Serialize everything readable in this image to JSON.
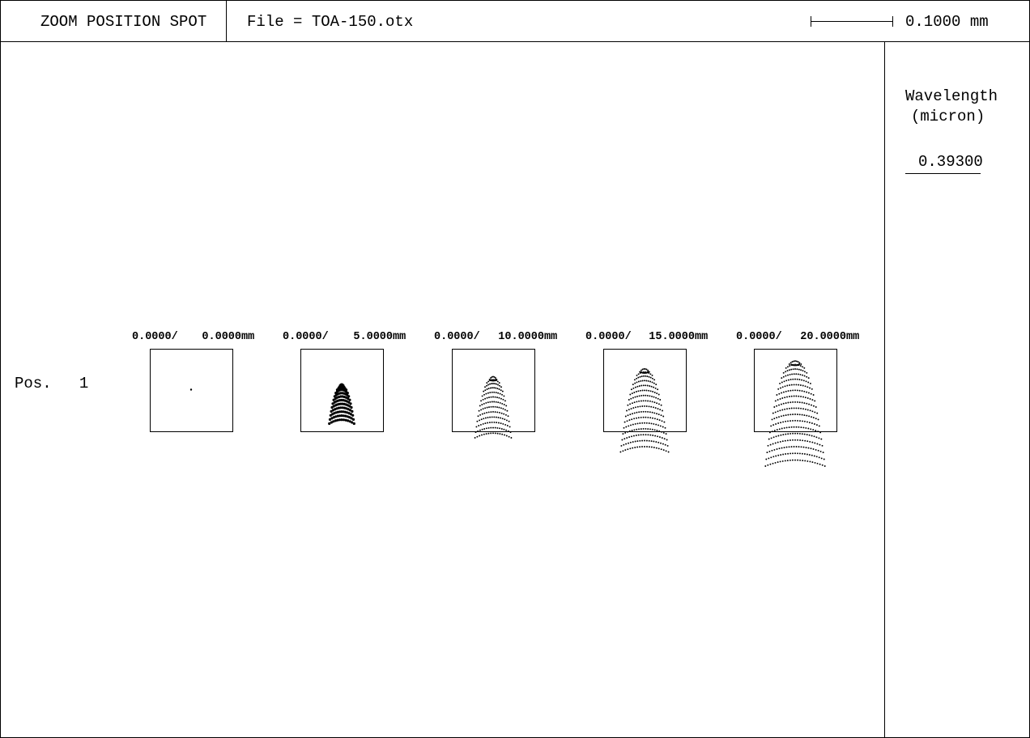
{
  "header": {
    "title": "ZOOM POSITION SPOT",
    "file": "File = TOA-150.otx",
    "scale_label": "0.1000 mm"
  },
  "sidebar": {
    "wavelength_title": "Wavelength",
    "wavelength_unit": "(micron)",
    "wavelength_value": "0.39300"
  },
  "row": {
    "label": "Pos.   1"
  },
  "fields": [
    {
      "x_text": "0.0000/",
      "y_text": "0.0000",
      "unit": "mm",
      "spread": 0.0
    },
    {
      "x_text": "0.0000/",
      "y_text": "5.0000",
      "unit": "mm",
      "spread": 0.25
    },
    {
      "x_text": "0.0000/",
      "y_text": "10.0000",
      "unit": "mm",
      "spread": 0.5
    },
    {
      "x_text": "0.0000/",
      "y_text": "15.0000",
      "unit": "mm",
      "spread": 0.75
    },
    {
      "x_text": "0.0000/",
      "y_text": "20.0000",
      "unit": "mm",
      "spread": 1.0
    }
  ],
  "colors": {
    "ink": "#000000",
    "paper": "#ffffff"
  }
}
